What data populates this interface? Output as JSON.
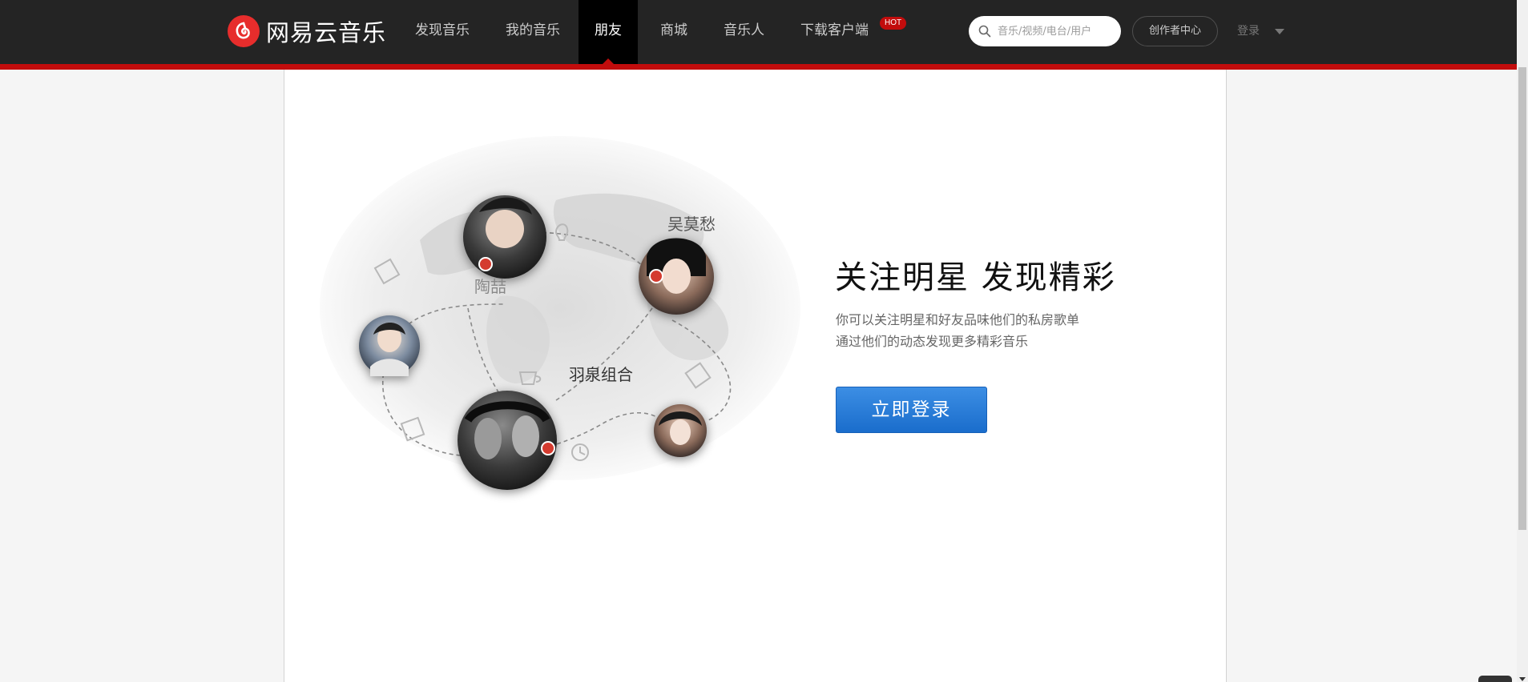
{
  "brand": {
    "name": "网易云音乐",
    "color": "#e72d2c",
    "icon": "netease-music-logo-icon"
  },
  "nav": {
    "items": [
      {
        "label": "发现音乐",
        "active": false
      },
      {
        "label": "我的音乐",
        "active": false
      },
      {
        "label": "朋友",
        "active": true
      },
      {
        "label": "商城",
        "active": false
      },
      {
        "label": "音乐人",
        "active": false
      },
      {
        "label": "下载客户端",
        "active": false
      }
    ],
    "hot_badge": "HOT"
  },
  "search": {
    "placeholder": "音乐/视频/电台/用户",
    "icon": "search-icon"
  },
  "header_actions": {
    "creator_center": "创作者中心",
    "login": "登录"
  },
  "hero": {
    "names": {
      "top_right": "吴莫愁",
      "left": "陶喆",
      "bottom_center": "羽泉组合"
    },
    "headline": "关注明星 发现精彩",
    "desc_line1": "你可以关注明星和好友品味他们的私房歌单",
    "desc_line2": "通过他们的动态发现更多精彩音乐",
    "cta": "立即登录"
  },
  "colors": {
    "topbar": "#242424",
    "accent_red": "#c20c0c",
    "cta_blue": "#2a7fd9",
    "page_bg": "#f5f5f5"
  }
}
